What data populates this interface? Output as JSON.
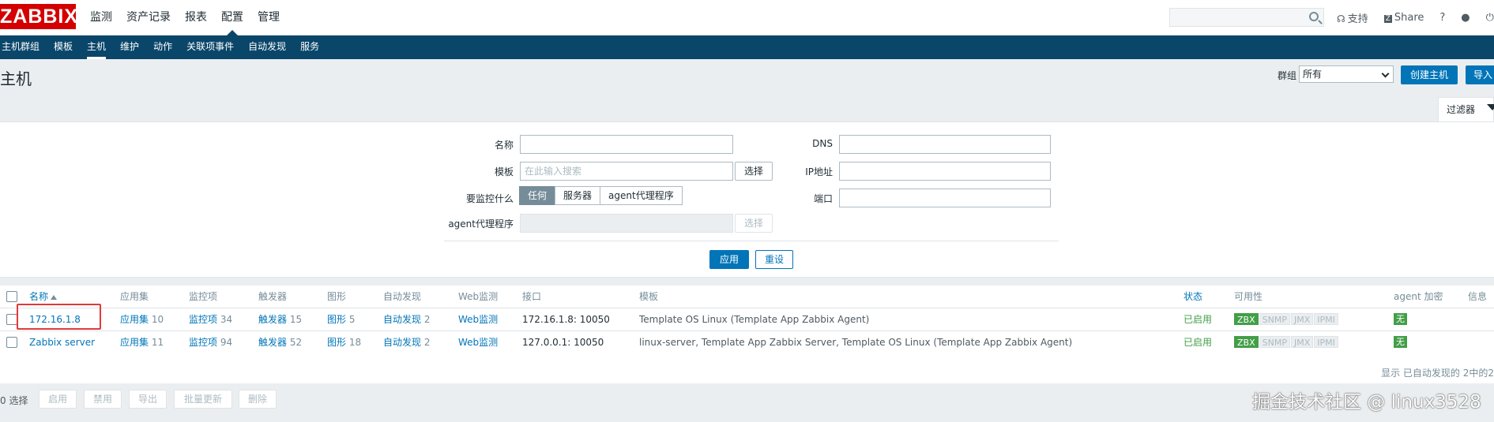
{
  "app": {
    "logo": "ZABBIX"
  },
  "main_menu": [
    "监测",
    "资产记录",
    "报表",
    "配置",
    "管理"
  ],
  "top_links": {
    "support": "支持",
    "share": "Share",
    "help": "?",
    "profile_icon": "user-icon",
    "logout_icon": "power-icon"
  },
  "sub_menu": [
    "主机群组",
    "模板",
    "主机",
    "维护",
    "动作",
    "关联项事件",
    "自动发现",
    "服务"
  ],
  "page": {
    "title": "主机",
    "group_label": "群组",
    "group_value": "所有",
    "create_button": "创建主机",
    "import_button": "导入"
  },
  "filter": {
    "tab_label": "过滤器",
    "name_label": "名称",
    "template_label": "模板",
    "template_placeholder": "在此输入搜索",
    "select_button": "选择",
    "monitored_by_label": "要监控什么",
    "monitored_by_options": [
      "任何",
      "服务器",
      "agent代理程序"
    ],
    "proxy_label": "agent代理程序",
    "proxy_select_button": "选择",
    "dns_label": "DNS",
    "ip_label": "IP地址",
    "port_label": "端口",
    "apply_button": "应用",
    "reset_button": "重设"
  },
  "table": {
    "headers": [
      "名称",
      "应用集",
      "监控项",
      "触发器",
      "图形",
      "自动发现",
      "Web监测",
      "接口",
      "模板",
      "状态",
      "可用性",
      "agent 加密",
      "信息"
    ],
    "rows": [
      {
        "name": "172.16.1.8",
        "apps": "应用集",
        "apps_count": "10",
        "items": "监控项",
        "items_count": "34",
        "triggers": "触发器",
        "triggers_count": "15",
        "graphs": "图形",
        "graphs_count": "5",
        "discovery": "自动发现",
        "discovery_count": "2",
        "web": "Web监测",
        "interface": "172.16.1.8: 10050",
        "templates": "Template OS Linux (Template App Zabbix Agent)",
        "status": "已启用",
        "encryption": "无"
      },
      {
        "name": "Zabbix server",
        "apps": "应用集",
        "apps_count": "11",
        "items": "监控项",
        "items_count": "94",
        "triggers": "触发器",
        "triggers_count": "52",
        "graphs": "图形",
        "graphs_count": "18",
        "discovery": "自动发现",
        "discovery_count": "2",
        "web": "Web监测",
        "interface": "127.0.0.1: 10050",
        "templates": "linux-server, Template App Zabbix Server, Template OS Linux (Template App Zabbix Agent)",
        "status": "已启用",
        "encryption": "无"
      }
    ],
    "availability": [
      "ZBX",
      "SNMP",
      "JMX",
      "IPMI"
    ],
    "footer": "显示 已自动发现的 2中的2"
  },
  "bottom_bar": {
    "selected": "0 选择",
    "buttons": [
      "启用",
      "禁用",
      "导出",
      "批量更新",
      "删除"
    ]
  },
  "watermark": "掘金技术社区 @ linux3528",
  "colors": {
    "brand": "#d40000",
    "nav": "#0a466a",
    "link": "#0275b8",
    "ok": "#429e47"
  }
}
